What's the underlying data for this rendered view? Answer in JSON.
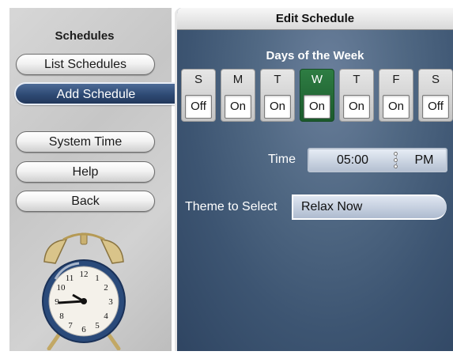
{
  "sidebar": {
    "title": "Schedules",
    "items": [
      {
        "label": "List Schedules",
        "active": false
      },
      {
        "label": "Add Schedule",
        "active": true
      },
      {
        "label": "System Time",
        "active": false
      },
      {
        "label": "Help",
        "active": false
      },
      {
        "label": "Back",
        "active": false
      }
    ]
  },
  "main": {
    "header": "Edit Schedule",
    "days_title": "Days of the Week",
    "days": [
      {
        "letter": "S",
        "state": "Off",
        "selected": false
      },
      {
        "letter": "M",
        "state": "On",
        "selected": false
      },
      {
        "letter": "T",
        "state": "On",
        "selected": false
      },
      {
        "letter": "W",
        "state": "On",
        "selected": true
      },
      {
        "letter": "T",
        "state": "On",
        "selected": false
      },
      {
        "letter": "F",
        "state": "On",
        "selected": false
      },
      {
        "letter": "S",
        "state": "Off",
        "selected": false
      }
    ],
    "time_label": "Time",
    "time_value": "05:00",
    "time_ampm": "PM",
    "theme_label": "Theme to Select",
    "theme_value": "Relax Now"
  },
  "icons": {
    "clock": "alarm-clock-icon"
  },
  "colors": {
    "active_nav": "#2e4a74",
    "selected_day": "#1f6a35",
    "panel_bg": "#4a6280"
  }
}
